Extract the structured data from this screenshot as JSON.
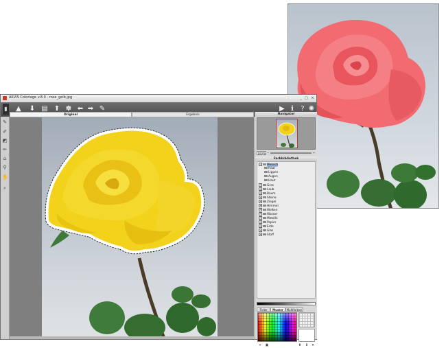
{
  "window": {
    "title": "AKVIS Coloriage v.8.0 - rose_gelb.jpg",
    "minimize": "_",
    "maximize": "□",
    "close": "×"
  },
  "toolbar": {
    "icons": [
      "open-icon",
      "save-icon",
      "print-icon",
      "upload-icon",
      "settings-gear-icon",
      "back-arrow-icon",
      "forward-arrow-icon",
      "brush-icon"
    ],
    "right_icons": [
      "play-icon",
      "info-icon",
      "help-icon",
      "preferences-icon"
    ],
    "glyphs": {
      "open": "▲",
      "save": "⬇",
      "print": "▤",
      "upload": "⬆",
      "settings": "✽",
      "back": "⬅",
      "forward": "➡",
      "brush": "✎",
      "play": "▶",
      "info": "ℹ",
      "help": "?",
      "prefs": "✺"
    }
  },
  "tabs": {
    "original": "Original",
    "result": "Ergebnis"
  },
  "navigator": {
    "title": "Navigator",
    "zoom": "100%"
  },
  "library": {
    "title": "Farbbibliothek",
    "items": [
      {
        "label": "Mensch",
        "level": 0,
        "selected": true
      },
      {
        "label": "Haar",
        "level": 1
      },
      {
        "label": "Lippen",
        "level": 1
      },
      {
        "label": "Augen",
        "level": 1
      },
      {
        "label": "Haut",
        "level": 1
      },
      {
        "label": "Gras",
        "level": 0
      },
      {
        "label": "Laub",
        "level": 0
      },
      {
        "label": "Baum",
        "level": 0
      },
      {
        "label": "Steine",
        "level": 0
      },
      {
        "label": "Ziegel",
        "level": 0
      },
      {
        "label": "Himmel",
        "level": 0
      },
      {
        "label": "Wolken",
        "level": 0
      },
      {
        "label": "Wasser",
        "level": 0
      },
      {
        "label": "Metalle",
        "level": 0
      },
      {
        "label": "Papier",
        "level": 0
      },
      {
        "label": "Erde",
        "level": 0
      },
      {
        "label": "Glas",
        "level": 0
      },
      {
        "label": "Stoff",
        "level": 0
      }
    ]
  },
  "palette_tabs": {
    "farbe": "Farbe",
    "muster": "Muster",
    "multifarben": "Multifarben"
  },
  "colors": {
    "rose_yellow": "#f2d21a",
    "rose_red": "#f0636a",
    "toolbar": "#555555",
    "canvas_bg": "#7f7f7f"
  }
}
